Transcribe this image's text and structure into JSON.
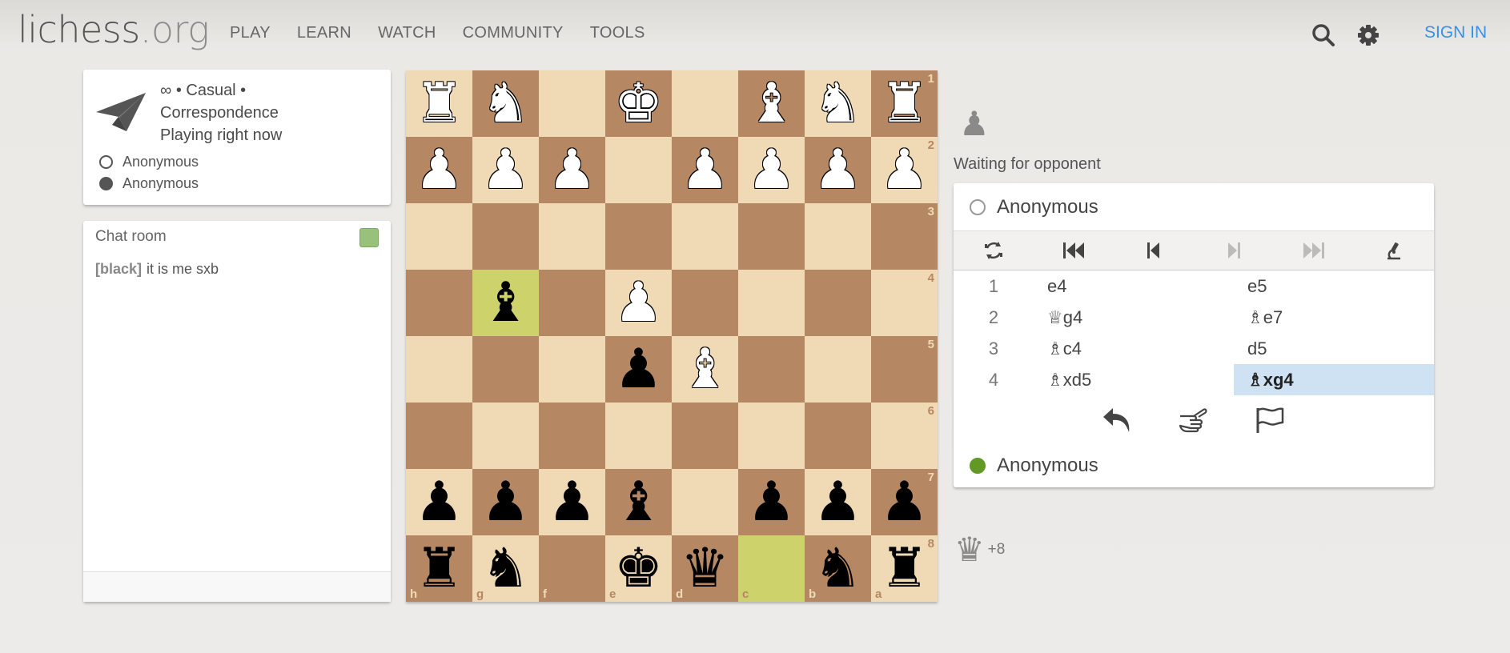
{
  "header": {
    "logo_main": "lichess",
    "logo_tld": ".org",
    "nav": [
      "PLAY",
      "LEARN",
      "WATCH",
      "COMMUNITY",
      "TOOLS"
    ],
    "signin": "SIGN IN",
    "icons": [
      "search-icon",
      "gear-icon"
    ]
  },
  "game_info": {
    "line1": "∞ • Casual •",
    "line2": "Correspondence",
    "line3": "Playing right now",
    "white_player": "Anonymous",
    "black_player": "Anonymous",
    "icon": "paper-plane-icon"
  },
  "chat": {
    "title": "Chat room",
    "messages": [
      {
        "user": "[black]",
        "text": "it is me sxb"
      }
    ]
  },
  "board": {
    "orientation": "black",
    "ranks": [
      "1",
      "2",
      "3",
      "4",
      "5",
      "6",
      "7",
      "8"
    ],
    "files": [
      "h",
      "g",
      "f",
      "e",
      "d",
      "c",
      "b",
      "a"
    ],
    "rows": [
      [
        "wR",
        "wN",
        "",
        "wK",
        "",
        "wB",
        "wN",
        "wR"
      ],
      [
        "wP",
        "wP",
        "wP",
        "",
        "wP",
        "wP",
        "wP",
        "wP"
      ],
      [
        "",
        "",
        "",
        "",
        "",
        "",
        "",
        ""
      ],
      [
        "",
        "bB",
        "",
        "wP",
        "",
        "",
        "",
        ""
      ],
      [
        "",
        "",
        "",
        "bP",
        "wB",
        "",
        "",
        ""
      ],
      [
        "",
        "",
        "",
        "",
        "",
        "",
        "",
        ""
      ],
      [
        "bP",
        "bP",
        "bP",
        "bB",
        "",
        "bP",
        "bP",
        "bP"
      ],
      [
        "bR",
        "bN",
        "",
        "bK",
        "bQ",
        "",
        "bN",
        "bR"
      ]
    ],
    "highlights": [
      [
        3,
        1
      ],
      [
        7,
        5
      ]
    ]
  },
  "right": {
    "waiting": "Waiting for opponent",
    "top_player": "Anonymous",
    "bottom_player": "Anonymous",
    "moves": [
      {
        "n": "1",
        "w": "e4",
        "b": "e5"
      },
      {
        "n": "2",
        "w": "♕g4",
        "b": "♗e7"
      },
      {
        "n": "3",
        "w": "♗c4",
        "b": "d5"
      },
      {
        "n": "4",
        "w": "♗xd5",
        "b": "♗xg4"
      }
    ],
    "active_move": "4b",
    "material_diff": "+8"
  }
}
